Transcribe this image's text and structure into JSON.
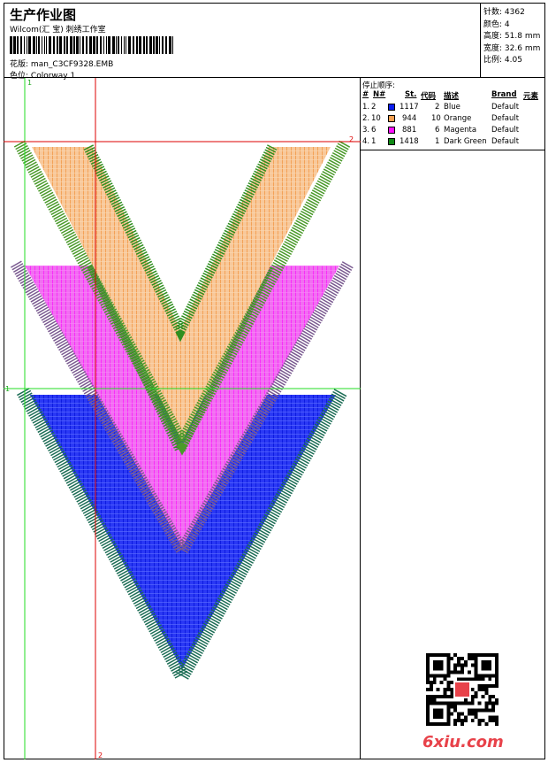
{
  "header": {
    "title": "生产作业图",
    "company": "Wilcom(汇 宝) 刺绣工作室",
    "file_label": "花版:",
    "file_name": "man_C3CF9328.EMB",
    "colorway_label": "色位:",
    "colorway_name": "Colorway 1"
  },
  "stats": [
    {
      "label": "针数:",
      "value": "4362"
    },
    {
      "label": "颜色:",
      "value": "4"
    },
    {
      "label": "高度:",
      "value": "51.8 mm"
    },
    {
      "label": "宽度:",
      "value": "32.6 mm"
    },
    {
      "label": "比例:",
      "value": "4.05"
    }
  ],
  "stop_sequence": {
    "title": "停止顺序:",
    "columns": {
      "idx": "#",
      "no": "N#",
      "st": "St.",
      "code": "代码",
      "desc": "描述",
      "brand": "Brand",
      "elem": "元素"
    },
    "rows": [
      {
        "idx": "1.",
        "no": "2",
        "color": "#0a1ef0",
        "st": "1117",
        "code": "2",
        "desc": "Blue",
        "brand": "Default"
      },
      {
        "idx": "2.",
        "no": "10",
        "color": "#f5a050",
        "st": "944",
        "code": "10",
        "desc": "Orange",
        "brand": "Default"
      },
      {
        "idx": "3.",
        "no": "6",
        "color": "#ff10ff",
        "st": "881",
        "code": "6",
        "desc": "Magenta",
        "brand": "Default"
      },
      {
        "idx": "4.",
        "no": "1",
        "color": "#0e8a14",
        "st": "1418",
        "code": "1",
        "desc": "Dark Green",
        "brand": "Default"
      }
    ]
  },
  "design": {
    "marker_top": "1",
    "marker_left": "1",
    "marker_right": "2",
    "marker_bottom": "2",
    "guide_green": "#22dd22",
    "guide_red": "#dd0000"
  },
  "watermark": "6xiu.com"
}
